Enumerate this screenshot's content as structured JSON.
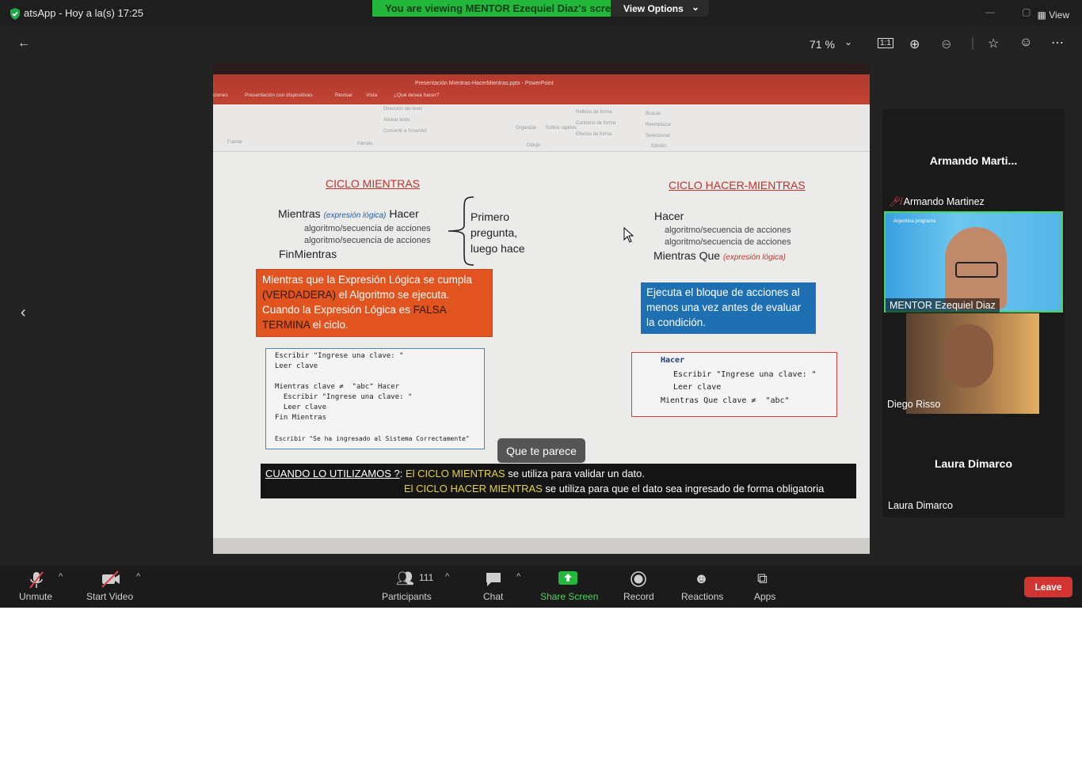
{
  "titlebar": {
    "title": "atsApp - Hoy a la(s) 17:25",
    "banner": "You are viewing MENTOR Ezequiel Diaz's screen",
    "view_options": "View Options",
    "view_right": "View"
  },
  "toolbar": {
    "zoom_level": "71 %"
  },
  "ppt": {
    "window_title": "Presentación Mientras-HacerMientras.pptx - PowerPoint",
    "menu": [
      "ciones",
      "Presentación con dispositivas",
      "Revisar",
      "Vista",
      "¿Qué desea hacer?"
    ],
    "ribbon_groups": [
      "Fuente",
      "Párrafo",
      "Dibujo",
      "Edición"
    ],
    "ribbon_items": [
      "Dirección del texto",
      "Alinear texto",
      "Convertir a SmartArt",
      "Organizar",
      "Estilos rápidos",
      "Relleno de forma",
      "Contorno de forma",
      "Efectos de forma",
      "Buscar",
      "Reemplazar",
      "Seleccionar"
    ]
  },
  "slide": {
    "left_title": "CICLO MIENTRAS",
    "right_title": "CICLO HACER-MIENTRAS",
    "mientras_line": "Mientras",
    "expr": "(expresión lógica)",
    "hacer_word": "Hacer",
    "algo1": "algoritmo/secuencia de acciones",
    "algo2": "algoritmo/secuencia de acciones",
    "fin": "FinMientras",
    "brace_text_1": "Primero",
    "brace_text_2": "pregunta,",
    "brace_text_3": "luego hace",
    "r_hacer": "Hacer",
    "r_algo1": "algoritmo/secuencia de acciones",
    "r_algo2": "algoritmo/secuencia de acciones",
    "r_mientras_que": "Mientras Que",
    "r_expr": "(expresión lógica)",
    "orange_1": "Mientras que la Expresión Lógica se cumpla",
    "orange_2a": "(VERDADERA)",
    "orange_2b": " el Algoritmo se ejecuta.",
    "orange_3a": "Cuando la Expresión Lógica es ",
    "orange_3b": "FALSA",
    "orange_4a": "TERMINA",
    "orange_4b": " el ciclo.",
    "blue_1": "Ejecuta el bloque de acciones al",
    "blue_2": "menos una vez antes de evaluar",
    "blue_3": "la condición.",
    "code_left": [
      "Escribir \"Ingrese una clave: \"",
      "Leer clave",
      "",
      "Mientras clave ≠  \"abc\" Hacer",
      "  Escribir \"Ingrese una clave: \"",
      "  Leer clave",
      "Fin Mientras",
      "",
      "Escribir \"Se ha ingresado al Sistema Correctamente\""
    ],
    "code_right": [
      "Hacer",
      "  Escribir \"Ingrese una clave: \"",
      "  Leer clave",
      "Mientras Que clave ≠  \"abc\""
    ],
    "bar_q": "CUANDO LO UTILIZAMOS ?",
    "bar_colon": ": ",
    "bar_1a": "El CICLO MIENTRAS",
    "bar_1b": "  se utiliza para validar un dato.",
    "bar_2a": "El CICLO HACER MIENTRAS",
    "bar_2b": " se utiliza para que el dato sea ingresado de forma obligatoria"
  },
  "caption": "Que te parece",
  "gallery": {
    "tile1_name": "Armando  Marti...",
    "tile1_label": "Armando Martinez",
    "tile2_label": "MENTOR Ezequiel Diaz",
    "tile2_logo_left": "Argentina programa",
    "tile3_label": "Diego Risso",
    "tile4_name": "Laura Dimarco",
    "tile4_label": "Laura Dimarco"
  },
  "bottombar": {
    "unmute": "Unmute",
    "start_video": "Start Video",
    "participants": "Participants",
    "participants_count": "111",
    "chat": "Chat",
    "share_screen": "Share Screen",
    "record": "Record",
    "reactions": "Reactions",
    "apps": "Apps",
    "leave": "Leave"
  },
  "colors": {
    "banner_green": "#23b83c",
    "leave_red": "#d23432",
    "share_green": "#23b83c",
    "active_speaker": "#4fd45b"
  }
}
